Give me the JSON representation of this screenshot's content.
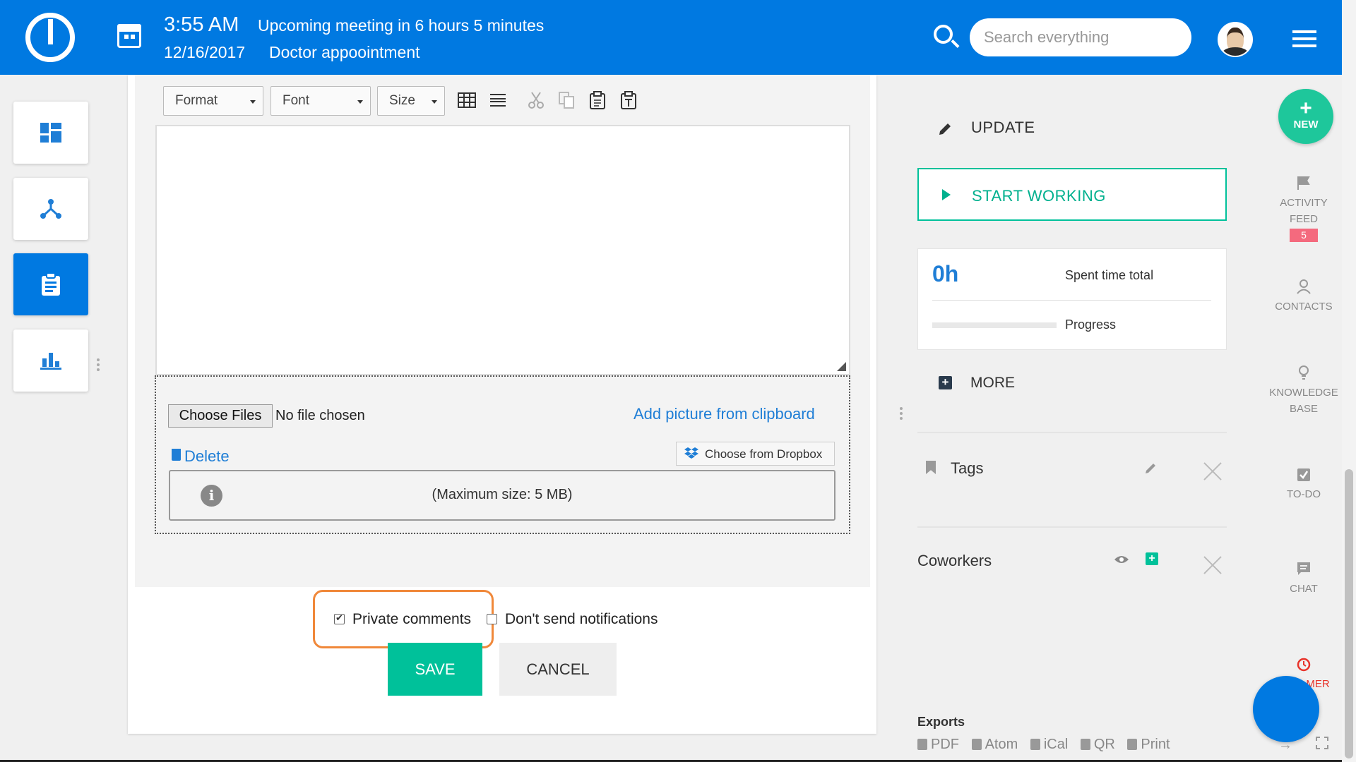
{
  "header": {
    "time": "3:55 AM",
    "meeting": "Upcoming meeting in 6 hours 5 minutes",
    "date": "12/16/2017",
    "appointment": "Doctor appoointment",
    "search_placeholder": "Search everything",
    "brand_color": "#0079e1"
  },
  "left_nav": {
    "items": [
      {
        "icon": "dashboard-icon"
      },
      {
        "icon": "network-icon"
      },
      {
        "icon": "clipboard-icon",
        "active": true
      },
      {
        "icon": "bar-chart-icon"
      }
    ]
  },
  "editor": {
    "toolbar": {
      "format_label": "Format",
      "font_label": "Font",
      "size_label": "Size",
      "icons": [
        "table-icon",
        "horizontal-line-icon",
        "cut-icon",
        "copy-icon",
        "paste-icon",
        "paste-text-icon"
      ]
    }
  },
  "upload": {
    "choose_label": "Choose Files",
    "no_file": "No file chosen",
    "add_clipboard": "Add picture from clipboard",
    "delete_label": "Delete",
    "dropbox_label": "Choose from Dropbox",
    "max_size": "(Maximum size: 5 MB)"
  },
  "form": {
    "private_comments": "Private comments",
    "private_checked": true,
    "dont_send": "Don't send notifications",
    "dont_send_checked": false,
    "save_label": "SAVE",
    "cancel_label": "CANCEL",
    "accent_color": "#00c19a"
  },
  "details": {
    "update_label": "UPDATE",
    "start_working": "START WORKING",
    "spent_value": "0h",
    "spent_label": "Spent time total",
    "progress_label": "Progress",
    "progress_value": 0,
    "more_label": "MORE",
    "tags_label": "Tags",
    "coworkers_label": "Coworkers",
    "exports_title": "Exports",
    "exports": [
      "PDF",
      "Atom",
      "iCal",
      "QR",
      "Print"
    ]
  },
  "right_sidebar": {
    "new_plus": "+",
    "new_label": "NEW",
    "activity_line1": "ACTIVITY",
    "activity_line2": "FEED",
    "activity_badge": "5",
    "contacts": "CONTACTS",
    "kb_line1": "KNOWLEDGE",
    "kb_line2": "BASE",
    "todo": "TO-DO",
    "chat": "CHAT",
    "timer": "MER"
  }
}
